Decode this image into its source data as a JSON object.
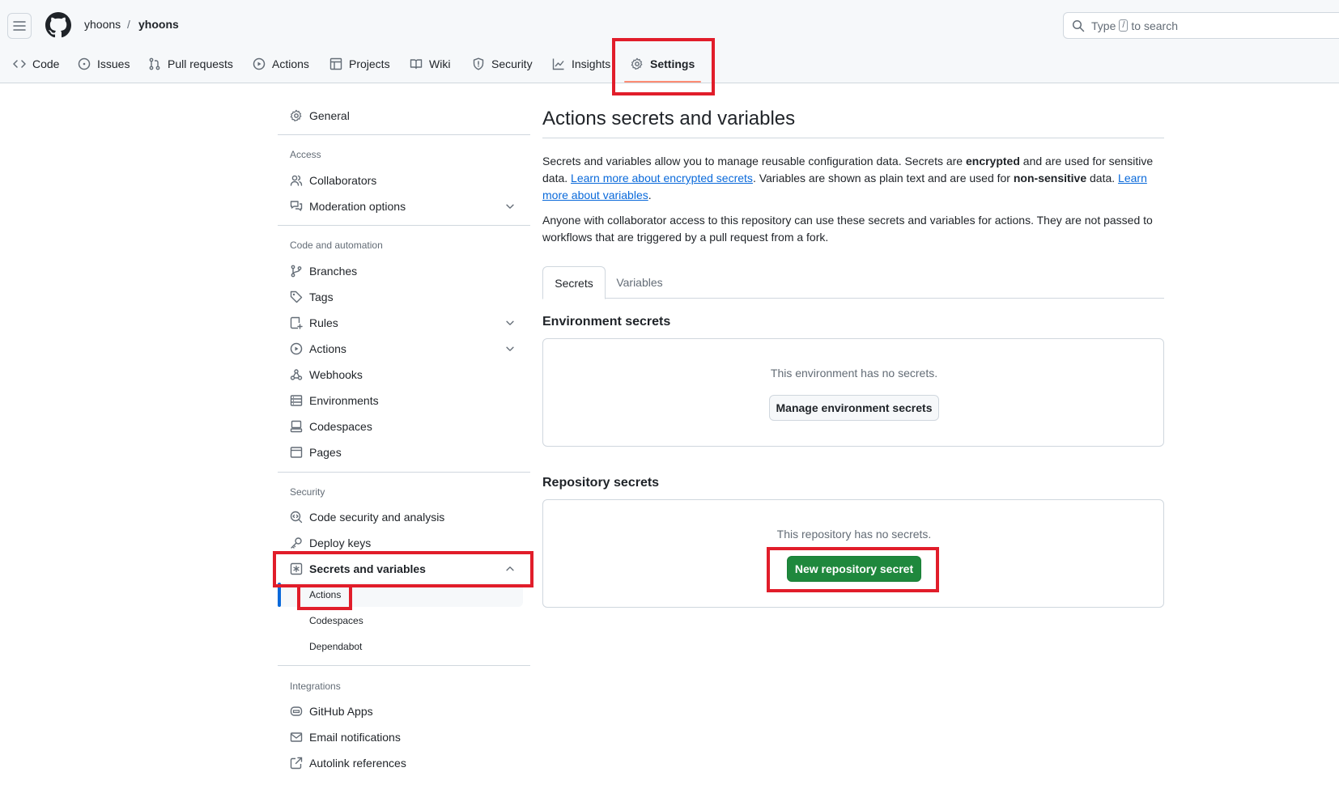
{
  "header": {
    "owner": "yhoons",
    "separator": "/",
    "repo": "yhoons",
    "search_type": "Type",
    "search_slash": "/",
    "search_rest": "to search"
  },
  "tabs": [
    {
      "label": "Code",
      "icon": "code-icon"
    },
    {
      "label": "Issues",
      "icon": "issue-opened-icon"
    },
    {
      "label": "Pull requests",
      "icon": "git-pull-request-icon"
    },
    {
      "label": "Actions",
      "icon": "play-icon"
    },
    {
      "label": "Projects",
      "icon": "table-icon"
    },
    {
      "label": "Wiki",
      "icon": "book-icon"
    },
    {
      "label": "Security",
      "icon": "shield-icon"
    },
    {
      "label": "Insights",
      "icon": "graph-icon"
    },
    {
      "label": "Settings",
      "icon": "gear-icon",
      "active": true
    }
  ],
  "sidebar": {
    "general": "General",
    "groups": {
      "access": "Access",
      "code_automation": "Code and automation",
      "security": "Security",
      "integrations": "Integrations"
    },
    "access_items": [
      "Collaborators",
      "Moderation options"
    ],
    "code_items": [
      "Branches",
      "Tags",
      "Rules",
      "Actions",
      "Webhooks",
      "Environments",
      "Codespaces",
      "Pages"
    ],
    "security_items": [
      "Code security and analysis",
      "Deploy keys",
      "Secrets and variables"
    ],
    "secrets_sub": [
      "Actions",
      "Codespaces",
      "Dependabot"
    ],
    "integration_items": [
      "GitHub Apps",
      "Email notifications",
      "Autolink references"
    ]
  },
  "main": {
    "title": "Actions secrets and variables",
    "desc1_a": "Secrets and variables allow you to manage reusable configuration data. Secrets are ",
    "desc1_b": "encrypted",
    "desc1_c": " and are used for sensitive data. ",
    "desc1_link1": "Learn more about encrypted secrets",
    "desc1_d": ". Variables are shown as plain text and are used for ",
    "desc1_e": "non-sensitive",
    "desc1_f": " data. ",
    "desc1_link2": "Learn more about variables",
    "desc1_g": ".",
    "desc2": "Anyone with collaborator access to this repository can use these secrets and variables for actions. They are not passed to workflows that are triggered by a pull request from a fork.",
    "subtabs": [
      "Secrets",
      "Variables"
    ],
    "env_heading": "Environment secrets",
    "env_empty": "This environment has no secrets.",
    "env_button": "Manage environment secrets",
    "repo_heading": "Repository secrets",
    "repo_empty": "This repository has no secrets.",
    "repo_button": "New repository secret"
  },
  "colors": {
    "accent_link": "#0969da",
    "primary_button": "#1f883d",
    "highlight_box": "#e11d2a",
    "active_tab_underline": "#fd8c73"
  }
}
